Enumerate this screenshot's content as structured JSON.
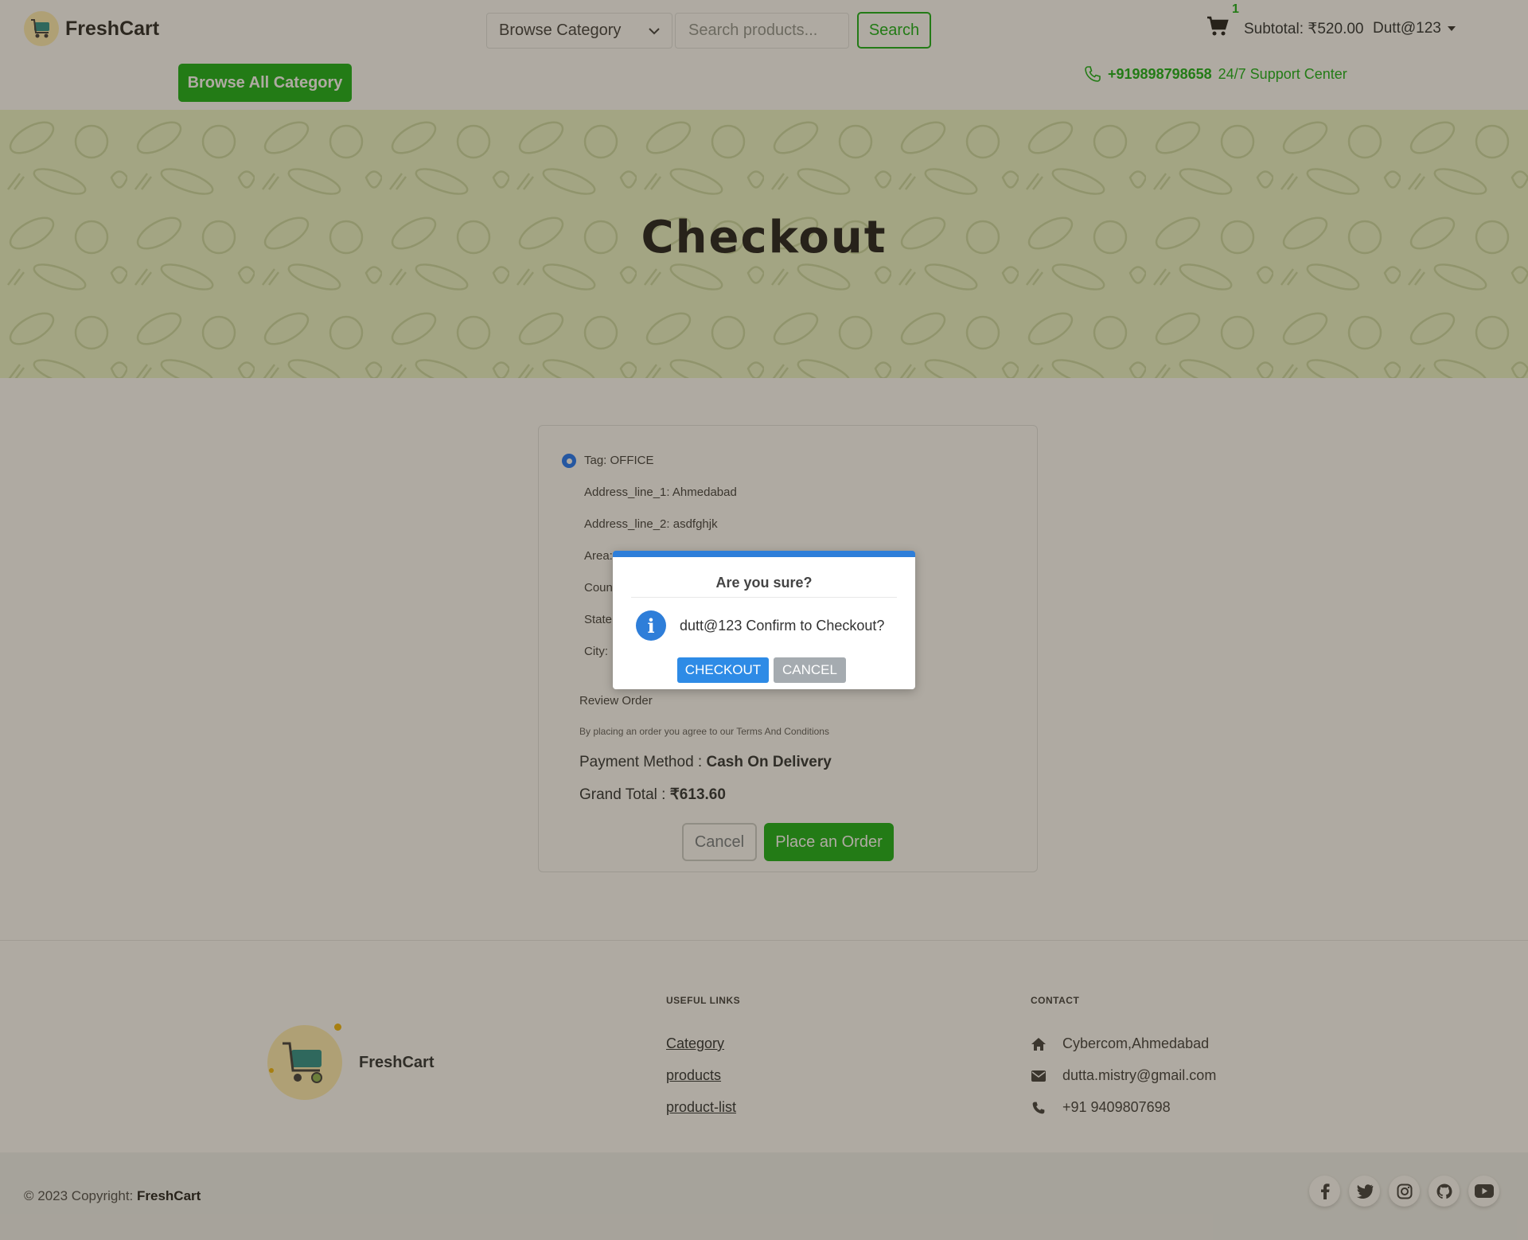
{
  "colors": {
    "brand_green": "#0aad0a",
    "banner_bg": "#eaf6c9",
    "modal_accent": "#2e7ed9",
    "overlay": "rgba(70,58,40,0.43)"
  },
  "header": {
    "brand": "FreshCart",
    "category_select": "Browse Category",
    "search_placeholder": "Search products...",
    "search_label": "Search",
    "cart_count": "1",
    "subtotal": "Subtotal: ₹520.00",
    "user": "Dutt@123",
    "browse_all": "Browse All Category",
    "support_phone": "+919898798658",
    "support_label": "24/7 Support Center",
    "icons": [
      "cart-icon",
      "caret-down-icon",
      "chevron-down-icon",
      "phone-icon"
    ]
  },
  "banner": {
    "title": "Checkout"
  },
  "checkout": {
    "tag": "Tag: OFFICE",
    "address_line_1": "Address_line_1: Ahmedabad",
    "address_line_2": "Address_line_2: asdfghjk",
    "area_label": "Area:",
    "country_label": "Coun",
    "state_label": "State",
    "city_label": "City:",
    "review_order": "Review Order",
    "terms": "By placing an order you agree to our Terms And Conditions",
    "payment_label": "Payment Method :",
    "payment_value": "Cash On Delivery",
    "total_label": "Grand Total :",
    "total_value": "₹613.60",
    "cancel_label": "Cancel",
    "place_order_label": "Place an Order"
  },
  "modal": {
    "title": "Are you sure?",
    "message": "dutt@123 Confirm to Checkout?",
    "confirm_label": "CHECKOUT",
    "cancel_label": "CANCEL",
    "icon": "info-icon"
  },
  "footer": {
    "brand": "FreshCart",
    "useful_links_heading": "USEFUL LINKS",
    "links": [
      "Category",
      "products",
      "product-list"
    ],
    "contact_heading": "CONTACT",
    "address": "Cybercom,Ahmedabad",
    "email": "dutta.mistry@gmail.com",
    "phone": "+91 9409807698",
    "copyright_prefix": "© 2023 Copyright:",
    "copyright_brand": "FreshCart",
    "social_icons": [
      "facebook-icon",
      "twitter-icon",
      "instagram-icon",
      "github-icon",
      "youtube-icon"
    ]
  }
}
